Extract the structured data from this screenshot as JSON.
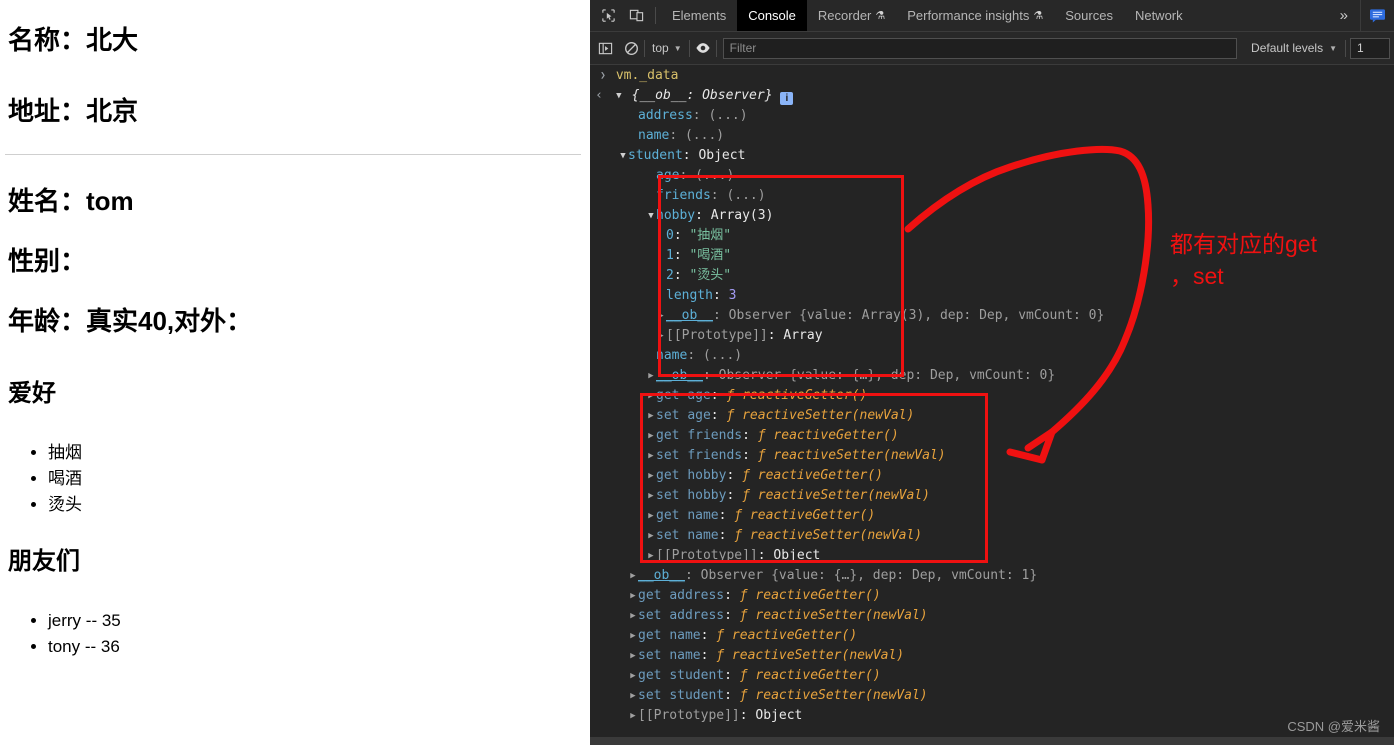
{
  "page": {
    "lines": [
      "名称：北大",
      "地址：北京",
      "姓名：tom",
      "性别：",
      "年龄：真实40,对外："
    ],
    "hobby_title": "爱好",
    "hobbies": [
      "抽烟",
      "喝酒",
      "烫头"
    ],
    "friends_title": "朋友们",
    "friends": [
      "jerry -- 35",
      "tony -- 36"
    ]
  },
  "devtools": {
    "tabs": [
      {
        "label": "Elements",
        "active": false,
        "flask": false
      },
      {
        "label": "Console",
        "active": true,
        "flask": false
      },
      {
        "label": "Recorder",
        "active": false,
        "flask": true
      },
      {
        "label": "Performance insights",
        "active": false,
        "flask": true
      },
      {
        "label": "Sources",
        "active": false,
        "flask": false
      },
      {
        "label": "Network",
        "active": false,
        "flask": false
      }
    ],
    "more_tabs_label": "»",
    "icons": {
      "inspect": "inspect-element-icon",
      "device": "device-toolbar-icon",
      "sidebar": "console-sidebar-icon",
      "clear": "clear-console-icon",
      "eye": "live-expression-icon",
      "issues": "issues-icon"
    },
    "flask_glyph": "⚗",
    "context_label": "top",
    "filter_placeholder": "Filter",
    "filter_value": "",
    "levels_label": "Default levels",
    "issue_count": "1",
    "caret_glyph": "▼"
  },
  "console": {
    "command": "vm._data",
    "root_preview": "{__ob__: Observer}",
    "rows": [
      {
        "id": "r0",
        "indent": 0,
        "type": "command",
        "text": "vm._data"
      },
      {
        "id": "r1",
        "indent": 0,
        "type": "result",
        "text": "{__ob__: Observer}"
      },
      {
        "id": "r2",
        "indent": 3,
        "key": "address",
        "val": "(...)"
      },
      {
        "id": "r3",
        "indent": 3,
        "key": "name",
        "val": "(...)"
      },
      {
        "id": "r4",
        "indent": 2,
        "key": "student",
        "val": "Object"
      },
      {
        "id": "r5",
        "indent": 3,
        "key": "age",
        "val": "(...)"
      },
      {
        "id": "r6",
        "indent": 3,
        "key": "friends",
        "val": "(...)"
      },
      {
        "id": "r7",
        "indent": 3,
        "key": "hobby",
        "val": "Array(3)"
      },
      {
        "id": "r8",
        "indent": 4,
        "key": "0",
        "val": "\"抽烟\""
      },
      {
        "id": "r9",
        "indent": 4,
        "key": "1",
        "val": "\"喝酒\""
      },
      {
        "id": "r10",
        "indent": 4,
        "key": "2",
        "val": "\"烫头\""
      },
      {
        "id": "r11",
        "indent": 4,
        "key": "length",
        "val": "3"
      },
      {
        "id": "r12",
        "indent": 4,
        "key": "__ob__",
        "val": "Observer {value: Array(3), dep: Dep, vmCount: 0}"
      },
      {
        "id": "r13",
        "indent": 4,
        "key": "[[Prototype]]",
        "val": "Array"
      },
      {
        "id": "r14",
        "indent": 3,
        "key": "name",
        "val": "(...)"
      },
      {
        "id": "r15",
        "indent": 3,
        "key": "__ob__",
        "val": "Observer {value: {…}, dep: Dep, vmCount: 0}"
      },
      {
        "id": "r16",
        "indent": 3,
        "key": "get age",
        "val": "ƒ reactiveGetter()"
      },
      {
        "id": "r17",
        "indent": 3,
        "key": "set age",
        "val": "ƒ reactiveSetter(newVal)"
      },
      {
        "id": "r18",
        "indent": 3,
        "key": "get friends",
        "val": "ƒ reactiveGetter()"
      },
      {
        "id": "r19",
        "indent": 3,
        "key": "set friends",
        "val": "ƒ reactiveSetter(newVal)"
      },
      {
        "id": "r20",
        "indent": 3,
        "key": "get hobby",
        "val": "ƒ reactiveGetter()"
      },
      {
        "id": "r21",
        "indent": 3,
        "key": "set hobby",
        "val": "ƒ reactiveSetter(newVal)"
      },
      {
        "id": "r22",
        "indent": 3,
        "key": "get name",
        "val": "ƒ reactiveGetter()"
      },
      {
        "id": "r23",
        "indent": 3,
        "key": "set name",
        "val": "ƒ reactiveSetter(newVal)"
      },
      {
        "id": "r24",
        "indent": 3,
        "key": "[[Prototype]]",
        "val": "Object"
      },
      {
        "id": "r25",
        "indent": 2,
        "key": "__ob__",
        "val": "Observer {value: {…}, dep: Dep, vmCount: 1}"
      },
      {
        "id": "r26",
        "indent": 2,
        "key": "get address",
        "val": "ƒ reactiveGetter()"
      },
      {
        "id": "r27",
        "indent": 2,
        "key": "set address",
        "val": "ƒ reactiveSetter(newVal)"
      },
      {
        "id": "r28",
        "indent": 2,
        "key": "get name",
        "val": "ƒ reactiveGetter()"
      },
      {
        "id": "r29",
        "indent": 2,
        "key": "set name",
        "val": "ƒ reactiveSetter(newVal)"
      },
      {
        "id": "r30",
        "indent": 2,
        "key": "get student",
        "val": "ƒ reactiveGetter()"
      },
      {
        "id": "r31",
        "indent": 2,
        "key": "set student",
        "val": "ƒ reactiveSetter(newVal)"
      },
      {
        "id": "r32",
        "indent": 2,
        "key": "[[Prototype]]",
        "val": "Object"
      }
    ],
    "labels": {
      "address": "address",
      "name": "name",
      "student": "student",
      "age": "age",
      "friends": "friends",
      "hobby": "hobby",
      "length": "length",
      "ob": "__ob__",
      "proto": "[[Prototype]]",
      "observer": "Observer",
      "object": "Object",
      "array": "Array",
      "array3": "Array(3)",
      "dots": "(...)",
      "h0": "\"抽烟\"",
      "h1": "\"喝酒\"",
      "h2": "\"烫头\"",
      "three": "3",
      "obs_arr": "Observer {value: Array(3), dep: Dep, vmCount: 0}",
      "obs_obj0": "Observer {value: {…}, dep: Dep, vmCount: 0}",
      "obs_obj1": "Observer {value: {…}, dep: Dep, vmCount: 1}",
      "getter": "ƒ reactiveGetter()",
      "setter": "ƒ reactiveSetter(newVal)",
      "get": "get",
      "set": "set"
    }
  },
  "annotations": {
    "note_text": "都有对应的get\n，set",
    "note_color": "#ef1111",
    "box_color": "#ef1111",
    "watermark": "CSDN @爱米酱"
  }
}
